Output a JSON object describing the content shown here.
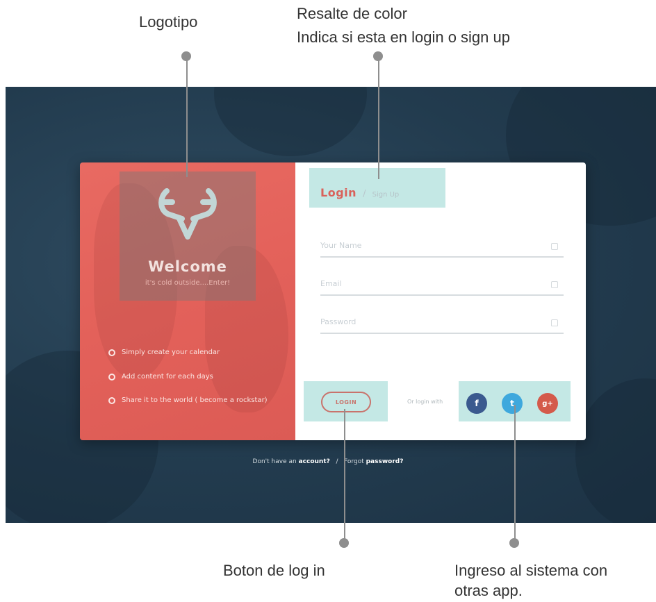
{
  "annotations": {
    "logo_label": "Logotipo",
    "highlight_label_line1": "Resalte de color",
    "highlight_label_line2": "Indica si esta en login o sign up",
    "login_button_label": "Boton de log in",
    "social_label_line1": "Ingreso al sistema con",
    "social_label_line2": "otras app."
  },
  "brand": {
    "logo_icon": "deer-antler-logo-icon",
    "welcome": "Welcome",
    "tagline": "it's cold outside....Enter!"
  },
  "features": [
    "Simply create your calendar",
    "Add content for each days",
    "Share it to the world ( become a rockstar)"
  ],
  "tabs": {
    "login": "Login",
    "separator": "/",
    "signup": "Sign Up"
  },
  "form": {
    "name_placeholder": "Your Name",
    "email_placeholder": "Email",
    "password_placeholder": "Password",
    "login_button": "LOGIN",
    "or_login_with": "Or login with"
  },
  "social": {
    "facebook": "f",
    "twitter": "t",
    "google": "g+"
  },
  "footer": {
    "prefix": "Don't have an",
    "account": "account?",
    "separator": "/",
    "forgot": "Forgot",
    "password": "password?"
  },
  "colors": {
    "accent_red": "#e3615a",
    "background_dark": "#223b4e",
    "highlight_teal": "#b4e2de",
    "facebook": "#3b5a8f",
    "twitter": "#3ea8dd",
    "google": "#d45a4b"
  }
}
